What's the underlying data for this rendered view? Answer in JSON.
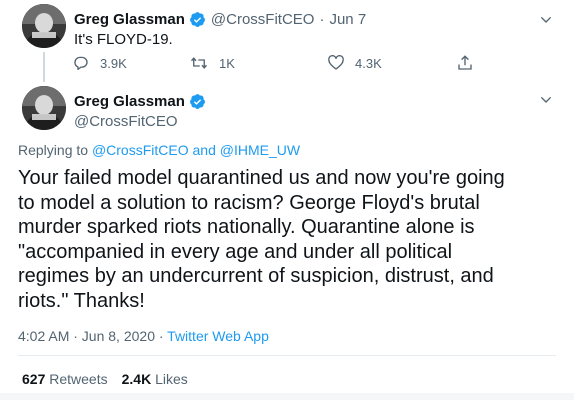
{
  "first_tweet": {
    "display_name": "Greg Glassman",
    "handle": "@CrossFitCEO",
    "separator": "·",
    "date": "Jun 7",
    "text": "It's FLOYD-19.",
    "actions": {
      "replies": "3.9K",
      "retweets": "1K",
      "likes": "4.3K"
    }
  },
  "main_tweet": {
    "display_name": "Greg Glassman",
    "handle": "@CrossFitCEO",
    "replying_prefix": "Replying to",
    "reply_mention_1": "@CrossFitCEO",
    "reply_and": "and",
    "reply_mention_2": "@IHME_UW",
    "text_lines": [
      "Your failed model quarantined us and now you're going",
      "to model a solution to racism? George Floyd's brutal",
      "murder sparked riots nationally. Quarantine alone is",
      "\"accompanied in every age and under all political",
      "regimes by an undercurrent of suspicion, distrust, and",
      "riots.\" Thanks!"
    ],
    "timestamp": "4:02 AM · Jun 8, 2020 ·",
    "source": "Twitter Web App",
    "retweet_count": "627",
    "retweet_label": "Retweets",
    "like_count": "2.4K",
    "like_label": "Likes"
  },
  "colors": {
    "accent": "#1d9bf0",
    "secondary_text": "#536471",
    "primary_text": "#0f1419"
  }
}
